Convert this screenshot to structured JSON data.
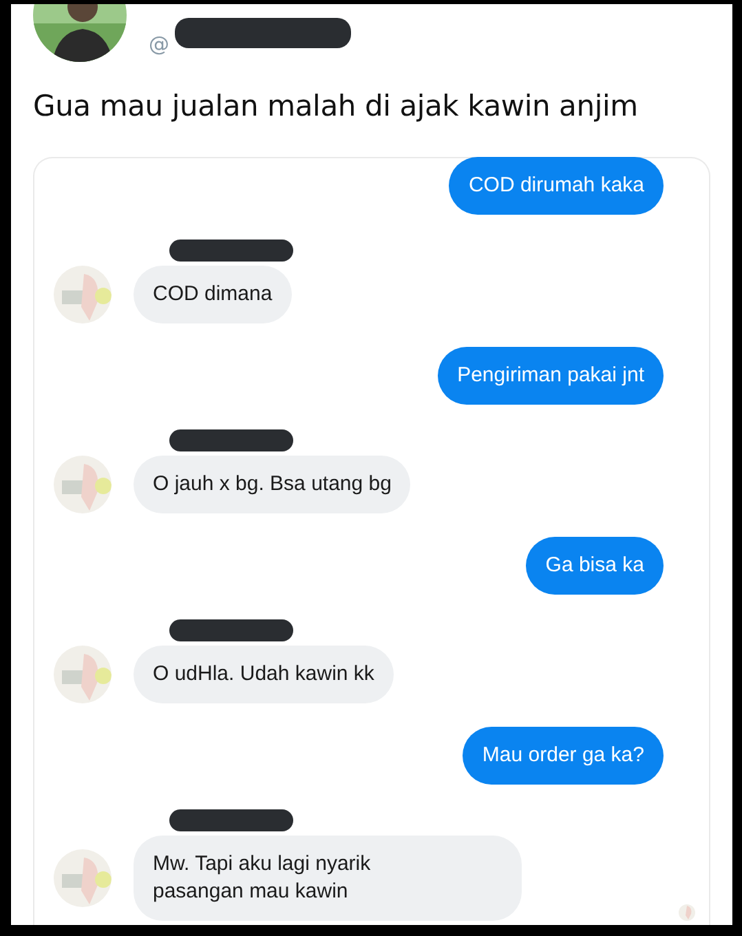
{
  "tweet": {
    "handle": "@",
    "handle_redacted": true,
    "text": "Gua mau jualan malah di ajak kawin anjim"
  },
  "messages": [
    {
      "kind": "outgoing",
      "text": "COD dirumah kaka",
      "seen": false
    },
    {
      "kind": "incoming",
      "text": "COD dimana",
      "seen": false
    },
    {
      "kind": "outgoing",
      "text": "Pengiriman pakai jnt",
      "seen": false
    },
    {
      "kind": "incoming",
      "text": "O jauh x bg. Bsa utang bg",
      "seen": false
    },
    {
      "kind": "outgoing",
      "text": "Ga bisa ka",
      "seen": false
    },
    {
      "kind": "incoming",
      "text": "O udHla. Udah kawin kk",
      "seen": false
    },
    {
      "kind": "outgoing",
      "text": "Mau order ga ka?",
      "seen": false
    },
    {
      "kind": "incoming",
      "text": "Mw. Tapi aku lagi nyarik\npasangan mau kawin",
      "seen": true
    }
  ]
}
